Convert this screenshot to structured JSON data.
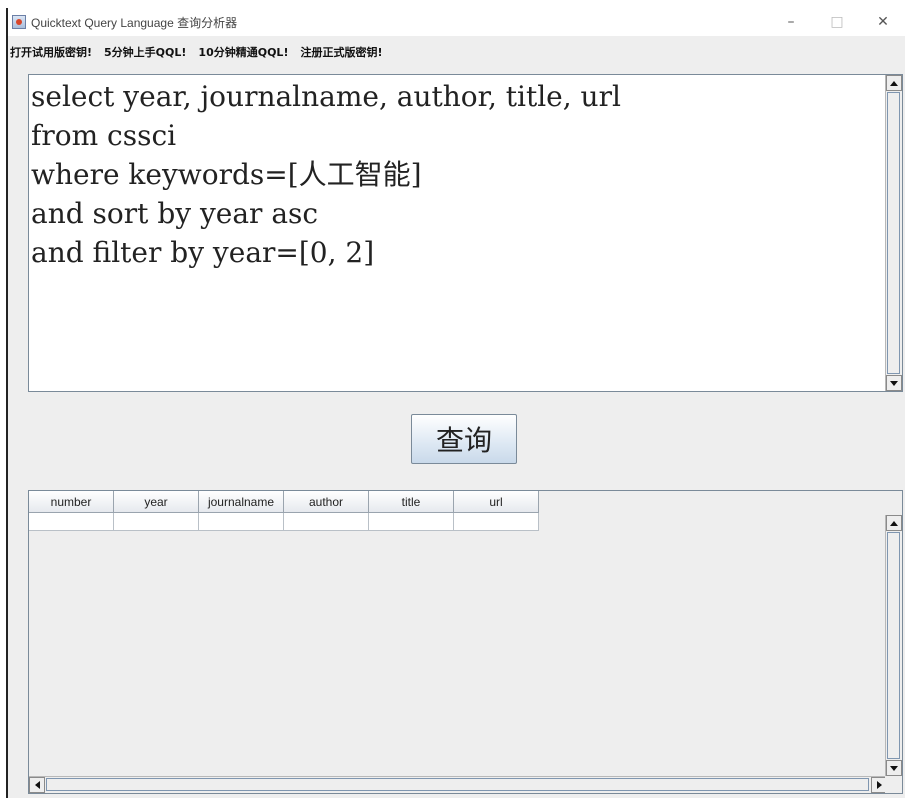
{
  "window": {
    "title": "Quicktext Query Language 查询分析器",
    "icon": "java-app-icon",
    "controls": {
      "minimize": "–",
      "maximize": "□",
      "close": "✕"
    }
  },
  "menu": {
    "items": [
      {
        "label": "打开试用版密钥!"
      },
      {
        "label": "5分钟上手QQL!"
      },
      {
        "label": "10分钟精通QQL!"
      },
      {
        "label": "注册正式版密钥!"
      }
    ]
  },
  "editor": {
    "query": "select year, journalname, author, title, url\nfrom cssci\nwhere keywords=[人工智能]\nand sort by year asc\nand filter by year=[0, 2]"
  },
  "query_button": {
    "label": "查询"
  },
  "results": {
    "columns": [
      "number",
      "year",
      "journalname",
      "author",
      "title",
      "url"
    ],
    "rows": [
      [
        "",
        "",
        "",
        "",
        "",
        ""
      ]
    ]
  },
  "colors": {
    "window_bg": "#eeeeee",
    "editor_bg": "#ffffff",
    "border": "#7a8a99",
    "button_gradient_end": "#c9d9ea"
  }
}
